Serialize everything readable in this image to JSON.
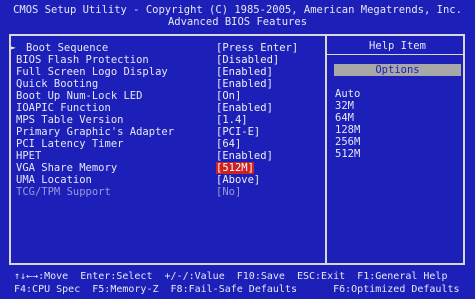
{
  "header": {
    "title": "CMOS Setup Utility - Copyright (C) 1985-2005, American Megatrends, Inc.",
    "subtitle": "Advanced BIOS Features"
  },
  "settings": [
    {
      "label": "Boot Sequence",
      "value": "[Press Enter]",
      "submenu": true
    },
    {
      "label": "BIOS Flash Protection",
      "value": "[Disabled]"
    },
    {
      "label": "Full Screen Logo Display",
      "value": "[Enabled]"
    },
    {
      "label": "Quick Booting",
      "value": "[Enabled]"
    },
    {
      "label": "Boot Up Num-Lock LED",
      "value": "[On]"
    },
    {
      "label": "IOAPIC Function",
      "value": "[Enabled]"
    },
    {
      "label": "MPS Table Version",
      "value": "[1.4]"
    },
    {
      "label": "Primary Graphic's Adapter",
      "value": "[PCI-E]"
    },
    {
      "label": "PCI Latency Timer",
      "value": "[64]"
    },
    {
      "label": "HPET",
      "value": "[Enabled]"
    },
    {
      "label": "VGA Share Memory",
      "value": "[512M]",
      "selected": true
    },
    {
      "label": "UMA Location",
      "value": "[Above]"
    },
    {
      "label": "TCG/TPM Support",
      "value": "[No]",
      "disabled": true
    }
  ],
  "help_panel": {
    "title": "Help Item",
    "options_label": "Options",
    "options": [
      "Auto",
      "32M",
      "64M",
      "128M",
      "256M",
      "512M"
    ]
  },
  "footer": {
    "line1": "↑↓←→:Move  Enter:Select  +/-/:Value  F10:Save  ESC:Exit  F1:General Help",
    "line2": "F4:CPU Spec  F5:Memory-Z  F8:Fail-Safe Defaults      F6:Optimized Defaults"
  },
  "colors": {
    "background": "#1c1fb8",
    "text": "#e8e8f4",
    "highlight": "#cc2222",
    "disabled": "#9a9ad8"
  }
}
